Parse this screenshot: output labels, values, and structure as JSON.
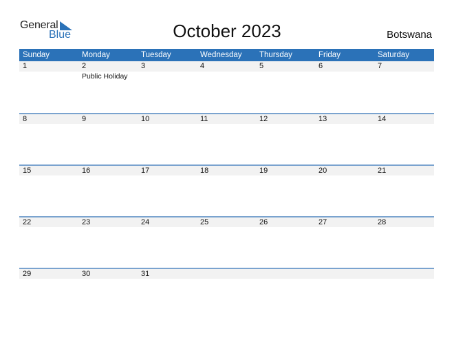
{
  "logo": {
    "word1": "General",
    "word2": "Blue"
  },
  "title": "October 2023",
  "country": "Botswana",
  "colors": {
    "accent": "#2b72b8",
    "strip": "#f2f2f2",
    "row_line": "#7aa3cf"
  },
  "weekdays": [
    "Sunday",
    "Monday",
    "Tuesday",
    "Wednesday",
    "Thursday",
    "Friday",
    "Saturday"
  ],
  "weeks": [
    {
      "days": [
        "1",
        "2",
        "3",
        "4",
        "5",
        "6",
        "7"
      ],
      "events": [
        "",
        "Public Holiday",
        "",
        "",
        "",
        "",
        ""
      ]
    },
    {
      "days": [
        "8",
        "9",
        "10",
        "11",
        "12",
        "13",
        "14"
      ],
      "events": [
        "",
        "",
        "",
        "",
        "",
        "",
        ""
      ]
    },
    {
      "days": [
        "15",
        "16",
        "17",
        "18",
        "19",
        "20",
        "21"
      ],
      "events": [
        "",
        "",
        "",
        "",
        "",
        "",
        ""
      ]
    },
    {
      "days": [
        "22",
        "23",
        "24",
        "25",
        "26",
        "27",
        "28"
      ],
      "events": [
        "",
        "",
        "",
        "",
        "",
        "",
        ""
      ]
    },
    {
      "days": [
        "29",
        "30",
        "31",
        "",
        "",
        "",
        ""
      ],
      "events": [
        "",
        "",
        "",
        "",
        "",
        "",
        ""
      ]
    }
  ]
}
